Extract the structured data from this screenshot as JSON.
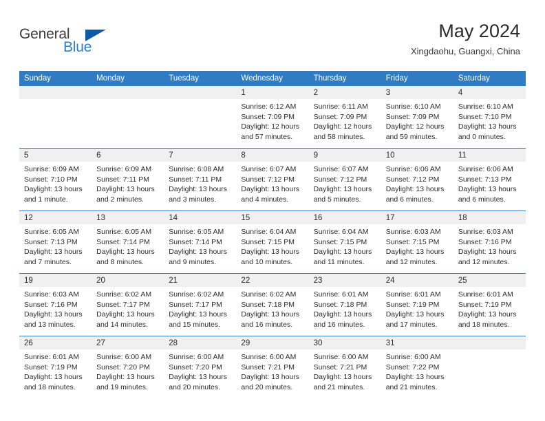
{
  "brand": {
    "name_part1": "General",
    "name_part2": "Blue",
    "triangle_icon": "triangle-icon",
    "accent_color": "#2a7fd4",
    "logo_triangle_color": "#0b5ca8"
  },
  "header": {
    "month_title": "May 2024",
    "location": "Xingdaohu, Guangxi, China"
  },
  "calendar": {
    "header_color": "#2f7cc4",
    "day_band_color": "#f0f0f0",
    "weekdays": [
      "Sunday",
      "Monday",
      "Tuesday",
      "Wednesday",
      "Thursday",
      "Friday",
      "Saturday"
    ],
    "weeks": [
      [
        {
          "day": "",
          "empty": true,
          "sunrise": "",
          "sunset": "",
          "daylight1": "",
          "daylight2": ""
        },
        {
          "day": "",
          "empty": true,
          "sunrise": "",
          "sunset": "",
          "daylight1": "",
          "daylight2": ""
        },
        {
          "day": "",
          "empty": true,
          "sunrise": "",
          "sunset": "",
          "daylight1": "",
          "daylight2": ""
        },
        {
          "day": "1",
          "empty": false,
          "sunrise": "Sunrise: 6:12 AM",
          "sunset": "Sunset: 7:09 PM",
          "daylight1": "Daylight: 12 hours",
          "daylight2": "and 57 minutes."
        },
        {
          "day": "2",
          "empty": false,
          "sunrise": "Sunrise: 6:11 AM",
          "sunset": "Sunset: 7:09 PM",
          "daylight1": "Daylight: 12 hours",
          "daylight2": "and 58 minutes."
        },
        {
          "day": "3",
          "empty": false,
          "sunrise": "Sunrise: 6:10 AM",
          "sunset": "Sunset: 7:09 PM",
          "daylight1": "Daylight: 12 hours",
          "daylight2": "and 59 minutes."
        },
        {
          "day": "4",
          "empty": false,
          "sunrise": "Sunrise: 6:10 AM",
          "sunset": "Sunset: 7:10 PM",
          "daylight1": "Daylight: 13 hours",
          "daylight2": "and 0 minutes."
        }
      ],
      [
        {
          "day": "5",
          "empty": false,
          "sunrise": "Sunrise: 6:09 AM",
          "sunset": "Sunset: 7:10 PM",
          "daylight1": "Daylight: 13 hours",
          "daylight2": "and 1 minute."
        },
        {
          "day": "6",
          "empty": false,
          "sunrise": "Sunrise: 6:09 AM",
          "sunset": "Sunset: 7:11 PM",
          "daylight1": "Daylight: 13 hours",
          "daylight2": "and 2 minutes."
        },
        {
          "day": "7",
          "empty": false,
          "sunrise": "Sunrise: 6:08 AM",
          "sunset": "Sunset: 7:11 PM",
          "daylight1": "Daylight: 13 hours",
          "daylight2": "and 3 minutes."
        },
        {
          "day": "8",
          "empty": false,
          "sunrise": "Sunrise: 6:07 AM",
          "sunset": "Sunset: 7:12 PM",
          "daylight1": "Daylight: 13 hours",
          "daylight2": "and 4 minutes."
        },
        {
          "day": "9",
          "empty": false,
          "sunrise": "Sunrise: 6:07 AM",
          "sunset": "Sunset: 7:12 PM",
          "daylight1": "Daylight: 13 hours",
          "daylight2": "and 5 minutes."
        },
        {
          "day": "10",
          "empty": false,
          "sunrise": "Sunrise: 6:06 AM",
          "sunset": "Sunset: 7:12 PM",
          "daylight1": "Daylight: 13 hours",
          "daylight2": "and 6 minutes."
        },
        {
          "day": "11",
          "empty": false,
          "sunrise": "Sunrise: 6:06 AM",
          "sunset": "Sunset: 7:13 PM",
          "daylight1": "Daylight: 13 hours",
          "daylight2": "and 6 minutes."
        }
      ],
      [
        {
          "day": "12",
          "empty": false,
          "sunrise": "Sunrise: 6:05 AM",
          "sunset": "Sunset: 7:13 PM",
          "daylight1": "Daylight: 13 hours",
          "daylight2": "and 7 minutes."
        },
        {
          "day": "13",
          "empty": false,
          "sunrise": "Sunrise: 6:05 AM",
          "sunset": "Sunset: 7:14 PM",
          "daylight1": "Daylight: 13 hours",
          "daylight2": "and 8 minutes."
        },
        {
          "day": "14",
          "empty": false,
          "sunrise": "Sunrise: 6:05 AM",
          "sunset": "Sunset: 7:14 PM",
          "daylight1": "Daylight: 13 hours",
          "daylight2": "and 9 minutes."
        },
        {
          "day": "15",
          "empty": false,
          "sunrise": "Sunrise: 6:04 AM",
          "sunset": "Sunset: 7:15 PM",
          "daylight1": "Daylight: 13 hours",
          "daylight2": "and 10 minutes."
        },
        {
          "day": "16",
          "empty": false,
          "sunrise": "Sunrise: 6:04 AM",
          "sunset": "Sunset: 7:15 PM",
          "daylight1": "Daylight: 13 hours",
          "daylight2": "and 11 minutes."
        },
        {
          "day": "17",
          "empty": false,
          "sunrise": "Sunrise: 6:03 AM",
          "sunset": "Sunset: 7:15 PM",
          "daylight1": "Daylight: 13 hours",
          "daylight2": "and 12 minutes."
        },
        {
          "day": "18",
          "empty": false,
          "sunrise": "Sunrise: 6:03 AM",
          "sunset": "Sunset: 7:16 PM",
          "daylight1": "Daylight: 13 hours",
          "daylight2": "and 12 minutes."
        }
      ],
      [
        {
          "day": "19",
          "empty": false,
          "sunrise": "Sunrise: 6:03 AM",
          "sunset": "Sunset: 7:16 PM",
          "daylight1": "Daylight: 13 hours",
          "daylight2": "and 13 minutes."
        },
        {
          "day": "20",
          "empty": false,
          "sunrise": "Sunrise: 6:02 AM",
          "sunset": "Sunset: 7:17 PM",
          "daylight1": "Daylight: 13 hours",
          "daylight2": "and 14 minutes."
        },
        {
          "day": "21",
          "empty": false,
          "sunrise": "Sunrise: 6:02 AM",
          "sunset": "Sunset: 7:17 PM",
          "daylight1": "Daylight: 13 hours",
          "daylight2": "and 15 minutes."
        },
        {
          "day": "22",
          "empty": false,
          "sunrise": "Sunrise: 6:02 AM",
          "sunset": "Sunset: 7:18 PM",
          "daylight1": "Daylight: 13 hours",
          "daylight2": "and 16 minutes."
        },
        {
          "day": "23",
          "empty": false,
          "sunrise": "Sunrise: 6:01 AM",
          "sunset": "Sunset: 7:18 PM",
          "daylight1": "Daylight: 13 hours",
          "daylight2": "and 16 minutes."
        },
        {
          "day": "24",
          "empty": false,
          "sunrise": "Sunrise: 6:01 AM",
          "sunset": "Sunset: 7:19 PM",
          "daylight1": "Daylight: 13 hours",
          "daylight2": "and 17 minutes."
        },
        {
          "day": "25",
          "empty": false,
          "sunrise": "Sunrise: 6:01 AM",
          "sunset": "Sunset: 7:19 PM",
          "daylight1": "Daylight: 13 hours",
          "daylight2": "and 18 minutes."
        }
      ],
      [
        {
          "day": "26",
          "empty": false,
          "sunrise": "Sunrise: 6:01 AM",
          "sunset": "Sunset: 7:19 PM",
          "daylight1": "Daylight: 13 hours",
          "daylight2": "and 18 minutes."
        },
        {
          "day": "27",
          "empty": false,
          "sunrise": "Sunrise: 6:00 AM",
          "sunset": "Sunset: 7:20 PM",
          "daylight1": "Daylight: 13 hours",
          "daylight2": "and 19 minutes."
        },
        {
          "day": "28",
          "empty": false,
          "sunrise": "Sunrise: 6:00 AM",
          "sunset": "Sunset: 7:20 PM",
          "daylight1": "Daylight: 13 hours",
          "daylight2": "and 20 minutes."
        },
        {
          "day": "29",
          "empty": false,
          "sunrise": "Sunrise: 6:00 AM",
          "sunset": "Sunset: 7:21 PM",
          "daylight1": "Daylight: 13 hours",
          "daylight2": "and 20 minutes."
        },
        {
          "day": "30",
          "empty": false,
          "sunrise": "Sunrise: 6:00 AM",
          "sunset": "Sunset: 7:21 PM",
          "daylight1": "Daylight: 13 hours",
          "daylight2": "and 21 minutes."
        },
        {
          "day": "31",
          "empty": false,
          "sunrise": "Sunrise: 6:00 AM",
          "sunset": "Sunset: 7:22 PM",
          "daylight1": "Daylight: 13 hours",
          "daylight2": "and 21 minutes."
        },
        {
          "day": "",
          "empty": true,
          "sunrise": "",
          "sunset": "",
          "daylight1": "",
          "daylight2": ""
        }
      ]
    ]
  }
}
